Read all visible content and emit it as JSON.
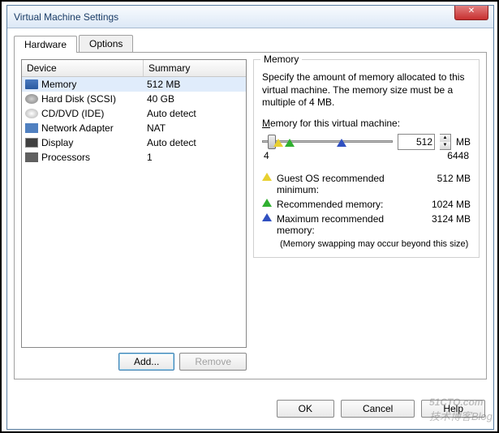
{
  "window": {
    "title": "Virtual Machine Settings"
  },
  "tabs": {
    "hardware": "Hardware",
    "options": "Options"
  },
  "device_table": {
    "col_device": "Device",
    "col_summary": "Summary",
    "rows": [
      {
        "name": "Memory",
        "summary": "512 MB"
      },
      {
        "name": "Hard Disk (SCSI)",
        "summary": "40 GB"
      },
      {
        "name": "CD/DVD (IDE)",
        "summary": "Auto detect"
      },
      {
        "name": "Network Adapter",
        "summary": "NAT"
      },
      {
        "name": "Display",
        "summary": "Auto detect"
      },
      {
        "name": "Processors",
        "summary": "1"
      }
    ],
    "add_btn": "Add...",
    "remove_btn": "Remove"
  },
  "memory": {
    "group_title": "Memory",
    "description": "Specify the amount of memory allocated to this virtual machine. The memory size must be a multiple of 4 MB.",
    "label": "Memory for this virtual machine:",
    "value": "512",
    "unit": "MB",
    "scale_min": "4",
    "scale_max": "6448",
    "rec_guest": "Guest OS recommended minimum:",
    "rec_guest_val": "512 MB",
    "rec_mem": "Recommended memory:",
    "rec_mem_val": "1024 MB",
    "rec_max": "Maximum recommended memory:",
    "rec_max_val": "3124 MB",
    "rec_note": "(Memory swapping may occur beyond this size)"
  },
  "footer": {
    "ok": "OK",
    "cancel": "Cancel",
    "help": "Help"
  },
  "watermark": {
    "main": "51CTO.com",
    "sub": "技术博客Blog"
  }
}
